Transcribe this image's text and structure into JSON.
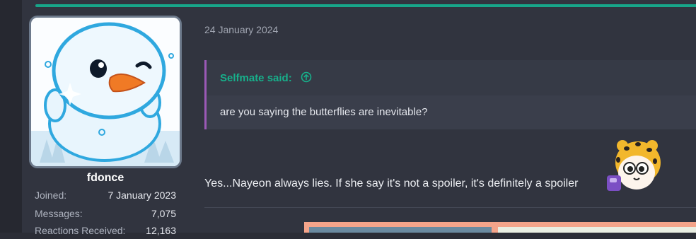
{
  "post": {
    "date": "24 January 2024",
    "quote": {
      "author_label": "Selfmate said:",
      "text": "are you saying the butterflies are inevitable?"
    },
    "reply_text": "Yes...Nayeon always lies. If she say it's not a spoiler, it's definitely a spoiler"
  },
  "user": {
    "username": "fdonce",
    "stats": [
      {
        "label": "Joined:",
        "value": "7 January 2023"
      },
      {
        "label": "Messages:",
        "value": "7,075"
      },
      {
        "label": "Reactions Received:",
        "value": "12,163"
      }
    ]
  },
  "icons": {
    "quote_jump": "arrow-up-circle-icon",
    "avatar": "snowman-avatar",
    "emote": "sticker-emote"
  },
  "colors": {
    "accent": "#17a589",
    "quote_author": "#17b08b",
    "quote_bar": "#9b59b6",
    "background": "#2b2d36"
  }
}
